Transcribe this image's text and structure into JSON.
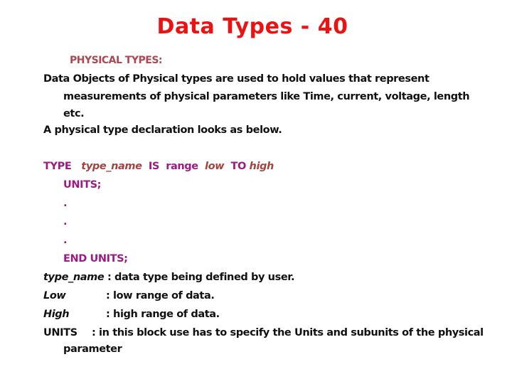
{
  "slide": {
    "title": "Data Types - 40",
    "subheading": "PHYSICAL TYPES:",
    "intro": {
      "line1": "Data Objects of Physical types are used to hold values that represent",
      "line2": "measurements of physical  parameters like Time, current, voltage, length",
      "line3": "etc.",
      "line4": "A physical type declaration looks as below."
    },
    "syntax": {
      "type_kw": "TYPE",
      "type_name": "type_name",
      "is_kw": "IS",
      "range_kw": "range",
      "low": "low",
      "to_kw": "TO",
      "high": "high",
      "units_line": "UNITS;",
      "dots": [
        ".",
        ".",
        "."
      ],
      "end_units": "END UNITS;"
    },
    "definitions": [
      {
        "term": "type_name",
        "separator": " : ",
        "desc": "data type being defined by user."
      },
      {
        "term": "Low",
        "separator": ":",
        "desc": " low range of  data."
      },
      {
        "term": "High",
        "separator": ":",
        "desc": " high range of data."
      },
      {
        "term": "UNITS",
        "separator": ":",
        "desc": " in this block use has to specify the Units and subunits of the physical"
      }
    ],
    "definitions_continuation": "parameter"
  },
  "colors": {
    "title": "#ee1111",
    "subheading": "#b0464f",
    "keyword": "#9b1b83",
    "identifier": "#a0453f",
    "body": "#111111"
  }
}
